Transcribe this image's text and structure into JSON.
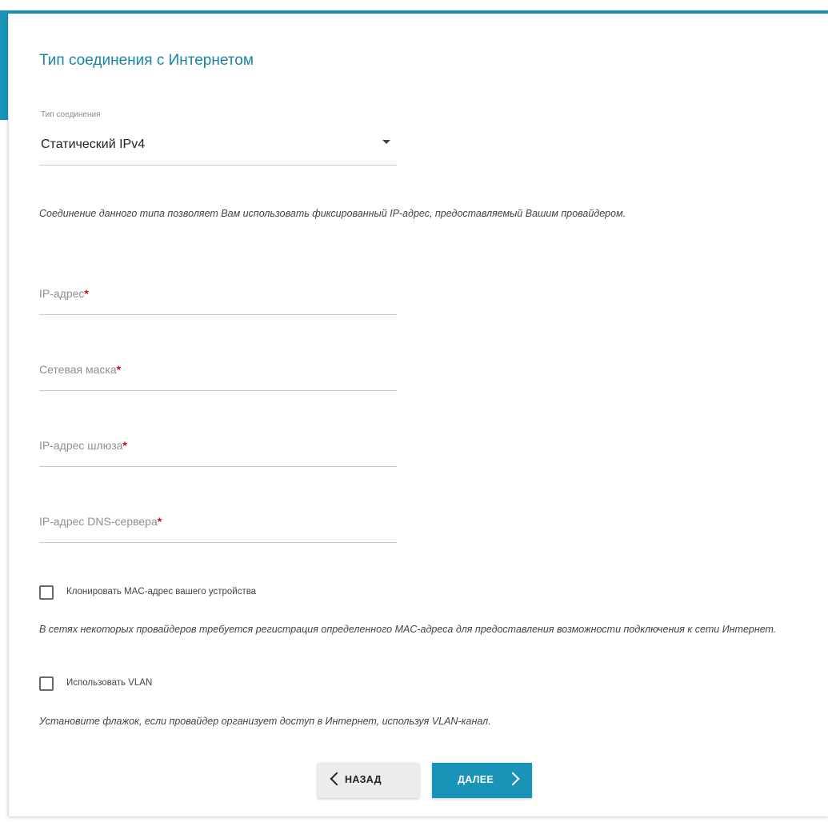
{
  "colors": {
    "accent": "#1a93b8",
    "title": "#1a85a8",
    "required": "#d0021b"
  },
  "header": {
    "title": "Тип соединения с Интернетом"
  },
  "connection_type": {
    "label": "Тип соединения",
    "value": "Статический IPv4",
    "description": "Соединение данного типа позволяет Вам использовать фиксированный IP-адрес, предоставляемый Вашим провайдером."
  },
  "fields": [
    {
      "label": "IP-адрес",
      "required_mark": "*",
      "value": ""
    },
    {
      "label": "Сетевая маска",
      "required_mark": "*",
      "value": ""
    },
    {
      "label": "IP-адрес шлюза",
      "required_mark": "*",
      "value": ""
    },
    {
      "label": "IP-адрес DNS-сервера",
      "required_mark": "*",
      "value": ""
    }
  ],
  "clone_mac": {
    "label": "Клонировать MAC-адрес вашего устройства",
    "checked": false,
    "description": "В сетях некоторых провайдеров требуется регистрация определенного MAC-адреса для предоставления возможности подключения к сети Интернет."
  },
  "vlan": {
    "label": "Использовать VLAN",
    "checked": false,
    "description": "Установите флажок, если провайдер организует доступ в Интернет, используя VLAN-канал."
  },
  "buttons": {
    "back": "НАЗАД",
    "next": "ДАЛЕЕ"
  },
  "icons": {
    "dropdown": "caret-down-icon",
    "back": "chevron-left-icon",
    "next": "chevron-right-icon"
  }
}
